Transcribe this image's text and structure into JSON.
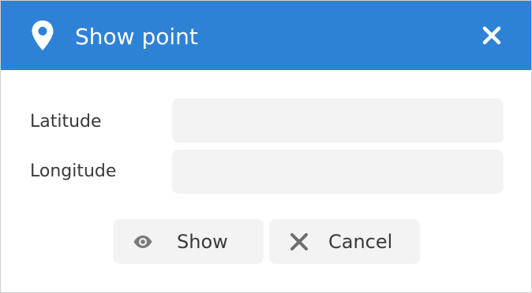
{
  "dialog": {
    "title": "Show point",
    "title_icon": "map-marker-icon",
    "close_icon": "close-icon",
    "accent_color": "#2e82d6"
  },
  "form": {
    "latitude_label": "Latitude",
    "latitude_value": "",
    "longitude_label": "Longitude",
    "longitude_value": ""
  },
  "buttons": {
    "show_label": "Show",
    "show_icon": "eye-icon",
    "cancel_label": "Cancel",
    "cancel_icon": "x-icon"
  }
}
